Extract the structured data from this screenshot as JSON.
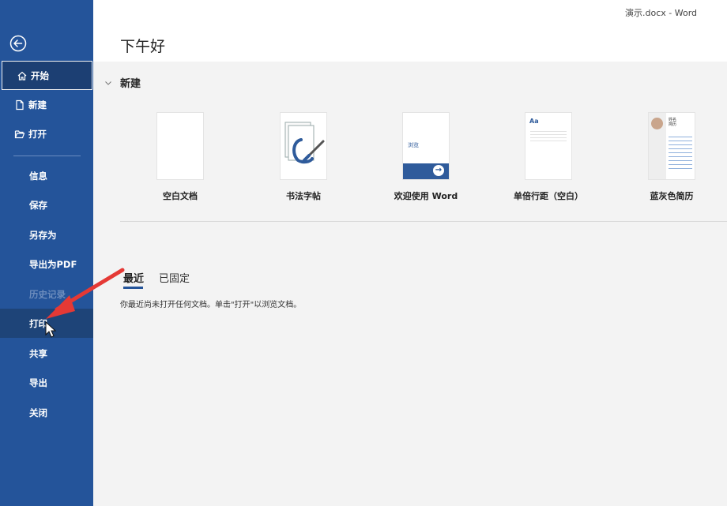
{
  "window": {
    "title": "演示.docx  -  Word"
  },
  "header": {
    "greeting": "下午好"
  },
  "sidebar": {
    "back": "back-arrow-icon",
    "items": [
      {
        "label": "开始",
        "icon": "home-icon",
        "state": "active"
      },
      {
        "label": "新建",
        "icon": "new-document-icon"
      },
      {
        "label": "打开",
        "icon": "open-folder-icon"
      },
      {
        "label": "信息"
      },
      {
        "label": "保存"
      },
      {
        "label": "另存为"
      },
      {
        "label": "导出为PDF"
      },
      {
        "label": "历史记录",
        "state": "disabled"
      },
      {
        "label": "打印",
        "state": "hovered"
      },
      {
        "label": "共享"
      },
      {
        "label": "导出"
      },
      {
        "label": "关闭"
      }
    ]
  },
  "new_section": {
    "title": "新建",
    "templates": [
      {
        "label": "空白文档"
      },
      {
        "label": "书法字帖"
      },
      {
        "label": "欢迎使用 Word",
        "thumb_text": "浏览"
      },
      {
        "label": "单倍行距（空白）",
        "thumb_text": "Aa"
      },
      {
        "label": "蓝灰色简历",
        "thumb_text": "姓名\n简历"
      }
    ]
  },
  "recent": {
    "tabs": [
      {
        "label": "最近",
        "active": true
      },
      {
        "label": "已固定"
      }
    ],
    "empty_message": "你最近尚未打开任何文档。单击\"打开\"以浏览文档。"
  },
  "colors": {
    "sidebar": "#24549a",
    "annotation_arrow": "#e53935"
  }
}
